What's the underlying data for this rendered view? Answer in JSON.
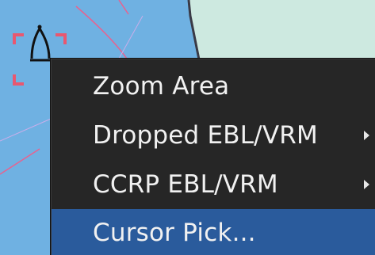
{
  "map": {
    "water_color": "#6fb1e2",
    "land_color": "#cde9e0",
    "route_color": "#e8628f",
    "cursor_color": "#e85870"
  },
  "context_menu": {
    "items": [
      {
        "label": "Zoom Area",
        "has_submenu": false,
        "highlighted": false
      },
      {
        "label": "Dropped EBL/VRM",
        "has_submenu": true,
        "highlighted": false
      },
      {
        "label": "CCRP EBL/VRM",
        "has_submenu": true,
        "highlighted": false
      },
      {
        "label": "Cursor Pick...",
        "has_submenu": false,
        "highlighted": true
      }
    ],
    "background_color": "#262626",
    "highlight_color": "#2a5b9c"
  }
}
